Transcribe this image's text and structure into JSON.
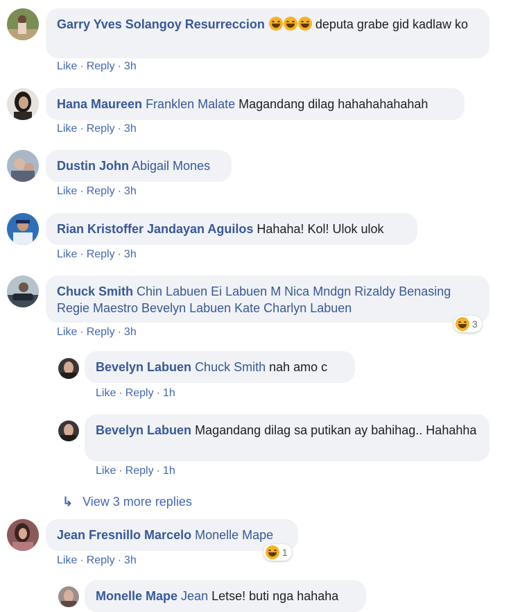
{
  "comments": [
    {
      "author": "Garry Yves Solangoy Resurreccion",
      "text": "deputa grabe gid kadlaw ko",
      "like": "Like",
      "reply": "Reply",
      "time": "3h"
    },
    {
      "author": "Hana Maureen",
      "tag": "Franklen Malate",
      "text": "Magandang dilag hahahahahahah",
      "like": "Like",
      "reply": "Reply",
      "time": "3h"
    },
    {
      "author": "Dustin John",
      "tag": "Abigail Mones",
      "like": "Like",
      "reply": "Reply",
      "time": "3h"
    },
    {
      "author": "Rian Kristoffer Jandayan Aguilos",
      "text": "Hahaha! Kol! Ulok ulok",
      "like": "Like",
      "reply": "Reply",
      "time": "3h"
    },
    {
      "author": "Chuck Smith",
      "tag": "Chin Labuen Ei Labuen M Nica Mndgn Rizaldy Benasing Regie Maestro Bevelyn Labuen Kate Charlyn Labuen",
      "like": "Like",
      "reply": "Reply",
      "time": "3h",
      "reaction_count": "3"
    },
    {
      "author": "Jean Fresnillo Marcelo",
      "tag": "Monelle Mape",
      "like": "Like",
      "reply": "Reply",
      "time": "3h",
      "reaction_count": "1"
    }
  ],
  "replies": [
    {
      "author": "Bevelyn Labuen",
      "tag": "Chuck Smith",
      "text": "nah amo c",
      "like": "Like",
      "reply": "Reply",
      "time": "1h"
    },
    {
      "author": "Bevelyn Labuen",
      "text": "Magandang dilag sa putikan ay bahihag.. Hahahha",
      "like": "Like",
      "reply": "Reply",
      "time": "1h"
    },
    {
      "author": "Monelle Mape",
      "tag": "Jean",
      "text": "Letse! buti nga hahaha"
    }
  ],
  "view_more": "View 3 more replies",
  "separator": "·",
  "colors": {
    "link": "#385898",
    "action": "#4267b2",
    "bubble": "#f0f2f5",
    "meta": "#606770"
  }
}
